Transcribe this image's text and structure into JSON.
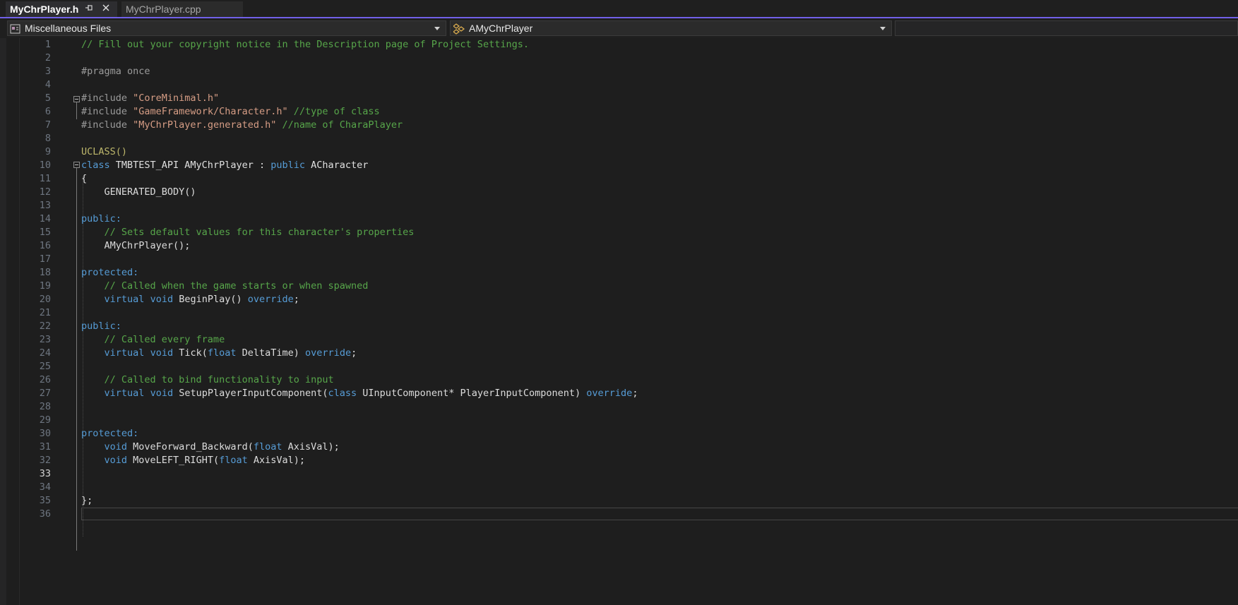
{
  "tabs": [
    {
      "label": "MyChrPlayer.h",
      "active": true
    },
    {
      "label": "MyChrPlayer.cpp",
      "active": false
    }
  ],
  "nav": {
    "files_label": "Miscellaneous Files",
    "class_label": "AMyChrPlayer"
  },
  "colors": {
    "accent": "#7160e8",
    "comment": "#57a64a",
    "keyword": "#569cd6",
    "string": "#d69d85",
    "macro": "#bdb76b"
  },
  "editor": {
    "current_line": "33",
    "lines": [
      {
        "n": "1",
        "text": "// Fill out your copyright notice in the Description page of Project Settings."
      },
      {
        "n": "2",
        "text": ""
      },
      {
        "n": "3",
        "text": "#pragma once"
      },
      {
        "n": "4",
        "text": ""
      },
      {
        "n": "5",
        "text": "#include \"CoreMinimal.h\""
      },
      {
        "n": "6",
        "text": "#include \"GameFramework/Character.h\" //type of class"
      },
      {
        "n": "7",
        "text": "#include \"MyChrPlayer.generated.h\" //name of CharaPlayer"
      },
      {
        "n": "8",
        "text": ""
      },
      {
        "n": "9",
        "text": "UCLASS()"
      },
      {
        "n": "10",
        "text": "class TMBTEST_API AMyChrPlayer : public ACharacter"
      },
      {
        "n": "11",
        "text": "{"
      },
      {
        "n": "12",
        "text": "    GENERATED_BODY()"
      },
      {
        "n": "13",
        "text": ""
      },
      {
        "n": "14",
        "text": "public:"
      },
      {
        "n": "15",
        "text": "    // Sets default values for this character's properties"
      },
      {
        "n": "16",
        "text": "    AMyChrPlayer();"
      },
      {
        "n": "17",
        "text": ""
      },
      {
        "n": "18",
        "text": "protected:"
      },
      {
        "n": "19",
        "text": "    // Called when the game starts or when spawned"
      },
      {
        "n": "20",
        "text": "    virtual void BeginPlay() override;"
      },
      {
        "n": "21",
        "text": ""
      },
      {
        "n": "22",
        "text": "public:"
      },
      {
        "n": "23",
        "text": "    // Called every frame"
      },
      {
        "n": "24",
        "text": "    virtual void Tick(float DeltaTime) override;"
      },
      {
        "n": "25",
        "text": ""
      },
      {
        "n": "26",
        "text": "    // Called to bind functionality to input"
      },
      {
        "n": "27",
        "text": "    virtual void SetupPlayerInputComponent(class UInputComponent* PlayerInputComponent) override;"
      },
      {
        "n": "28",
        "text": ""
      },
      {
        "n": "29",
        "text": ""
      },
      {
        "n": "30",
        "text": "protected:"
      },
      {
        "n": "31",
        "text": "    void MoveForward_Backward(float AxisVal);"
      },
      {
        "n": "32",
        "text": "    void MoveLEFT_RIGHT(float AxisVal);"
      },
      {
        "n": "33",
        "text": ""
      },
      {
        "n": "34",
        "text": ""
      },
      {
        "n": "35",
        "text": "};"
      },
      {
        "n": "36",
        "text": ""
      }
    ]
  }
}
